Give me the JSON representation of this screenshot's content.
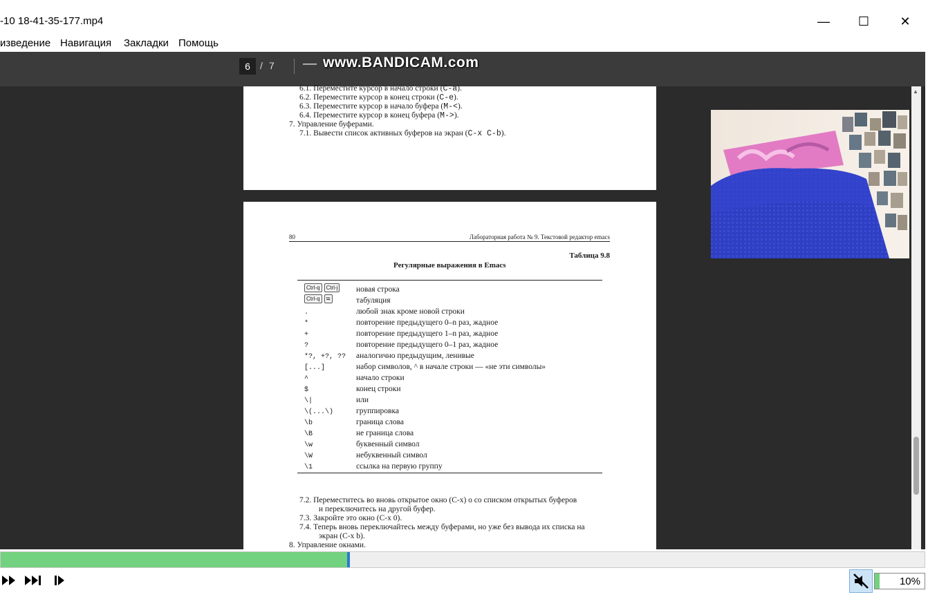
{
  "window": {
    "title": "-10 18-41-35-177.mp4",
    "minimize_glyph": "—",
    "maximize_glyph": "☐",
    "close_glyph": "✕"
  },
  "menu": [
    "изведение",
    "Навигация",
    "Закладки",
    "Помощь"
  ],
  "pdf_toolbar": {
    "page_current": "6",
    "page_sep": "/",
    "page_total": "7",
    "zoom_out": "—",
    "watermark": "www.BANDICAM.com"
  },
  "page1": {
    "lines": [
      {
        "num": "6.1.",
        "text": "Переместите курсор в начало строки",
        "code": "C-a",
        "end": "."
      },
      {
        "num": "6.2.",
        "text": "Переместите курсор в конец строки",
        "code": "C-e",
        "end": "."
      },
      {
        "num": "6.3.",
        "text": "Переместите курсор в начало буфера",
        "code": "M-<",
        "end": "."
      },
      {
        "num": "6.4.",
        "text": "Переместите курсор в конец буфера",
        "code": "M->",
        "end": "."
      },
      {
        "num": "7.",
        "text": "Управление буферами.",
        "code": "",
        "end": ""
      },
      {
        "num": "7.1.",
        "text": "Вывести список активных буферов на экран",
        "code": "C-x C-b",
        "end": "."
      }
    ]
  },
  "page2": {
    "page_number": "80",
    "running_header": "Лабораторная работа № 9. Текстовой редактор emacs",
    "table_label": "Таблица 9.8",
    "table_title": "Регулярные выражения в Emacs",
    "rows": [
      {
        "keys": [
          "Ctrl-q",
          "Ctrl-j"
        ],
        "expr": "",
        "desc": "новая строка"
      },
      {
        "keys": [
          "Ctrl-q",
          "⭾"
        ],
        "expr": "",
        "desc": "табуляция"
      },
      {
        "keys": [],
        "expr": ".",
        "desc": "любой знак кроме новой строки"
      },
      {
        "keys": [],
        "expr": "*",
        "desc": "повторение предыдущего 0–n раз, жадное"
      },
      {
        "keys": [],
        "expr": "+",
        "desc": "повторение предыдущего 1–n раз, жадное"
      },
      {
        "keys": [],
        "expr": "?",
        "desc": "повторение предыдущего 0–1 раз, жадное"
      },
      {
        "keys": [],
        "expr": "*?, +?, ??",
        "desc": "аналогично предыдущим, ленивые"
      },
      {
        "keys": [],
        "expr": "[...]",
        "desc": "набор символов, ^ в начале строки — «не эти символы»"
      },
      {
        "keys": [],
        "expr": "^",
        "desc": "начало строки"
      },
      {
        "keys": [],
        "expr": "$",
        "desc": "конец строки"
      },
      {
        "keys": [],
        "expr": "\\|",
        "desc": "или"
      },
      {
        "keys": [],
        "expr": "\\(...\\)",
        "desc": "группировка"
      },
      {
        "keys": [],
        "expr": "\\b",
        "desc": "граница слова"
      },
      {
        "keys": [],
        "expr": "\\B",
        "desc": "не граница слова"
      },
      {
        "keys": [],
        "expr": "\\w",
        "desc": "буквенный символ"
      },
      {
        "keys": [],
        "expr": "\\W",
        "desc": "небуквенный символ"
      },
      {
        "keys": [],
        "expr": "\\1",
        "desc": "ссылка на первую группу"
      }
    ],
    "after": [
      {
        "num": "7.2.",
        "text": "Переместитесь во вновь открытое окно (C-x) o со списком открытых буферов"
      },
      {
        "num": "",
        "text": "и переключитесь на другой буфер."
      },
      {
        "num": "7.3.",
        "text": "Закройте это окно (C-x 0)."
      },
      {
        "num": "7.4.",
        "text": "Теперь вновь переключайтесь между буферами, но уже без вывода их списка на"
      },
      {
        "num": "",
        "text": "экран (C-x b)."
      },
      {
        "num": "8.",
        "text": "Управление окнами."
      }
    ]
  },
  "player": {
    "progress": 0.375,
    "volume_label": "10%",
    "volume": 0.1
  },
  "colors": {
    "progress_fill": "#73d27f",
    "progress_head": "#2a7ad4"
  }
}
